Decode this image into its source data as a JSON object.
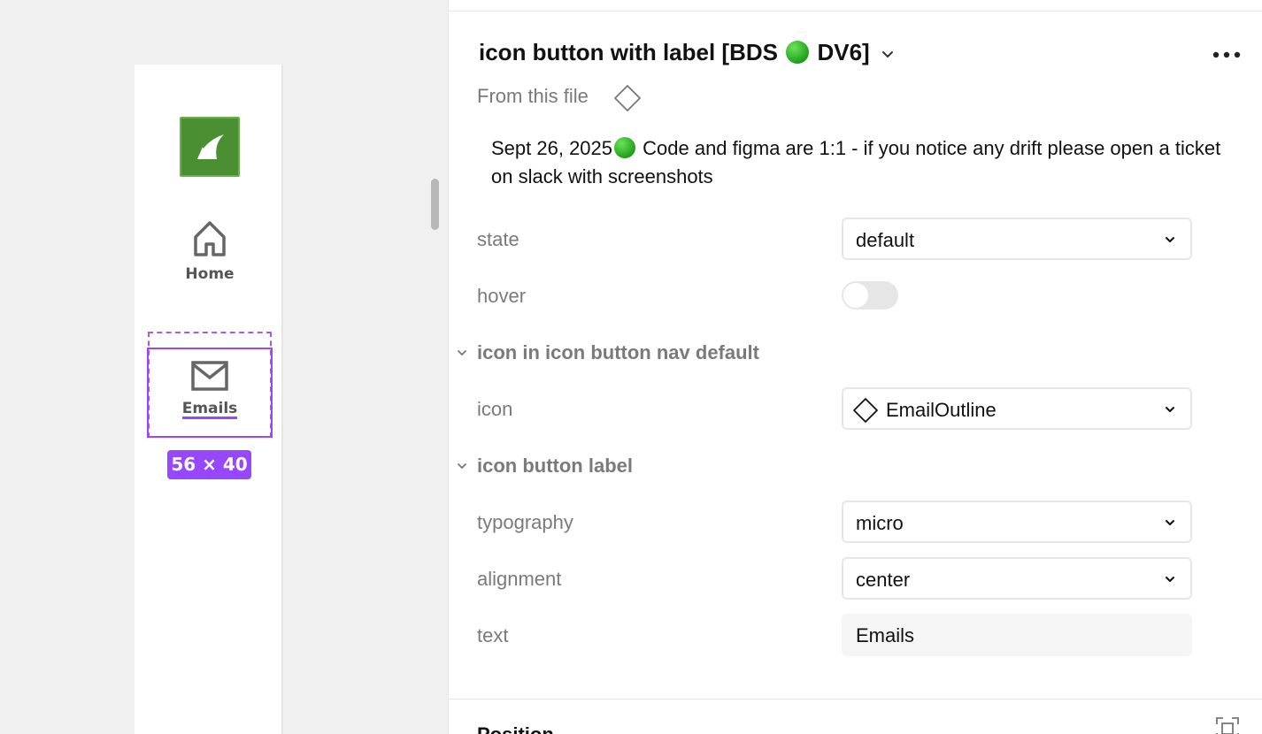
{
  "canvas": {
    "nav_items": [
      {
        "label": "Home",
        "icon": "home-icon"
      },
      {
        "label": "Emails",
        "icon": "email-outline-icon"
      }
    ],
    "selection_size": "56 × 40",
    "logo_icon": "barracuda-logo-icon",
    "colors": {
      "selection": "#9747ff",
      "logo_bg": "#4a8f32"
    }
  },
  "panel": {
    "title_prefix": "icon button with label [BDS",
    "title_suffix": "DV6]",
    "title_status": "green-circle",
    "from_file": "From this file",
    "description_date": "Sept 26, 2025",
    "description_text": " Code and figma are 1:1 - if you notice any drift please open a ticket on slack with screenshots",
    "props": {
      "state_label": "state",
      "state_value": "default",
      "hover_label": "hover",
      "hover_value": false,
      "section_icon": "icon in icon button nav default",
      "icon_label": "icon",
      "icon_value": "EmailOutline",
      "section_label": "icon button label",
      "typography_label": "typography",
      "typography_value": "micro",
      "alignment_label": "alignment",
      "alignment_value": "center",
      "text_label": "text",
      "text_value": "Emails"
    },
    "position_title": "Position"
  }
}
